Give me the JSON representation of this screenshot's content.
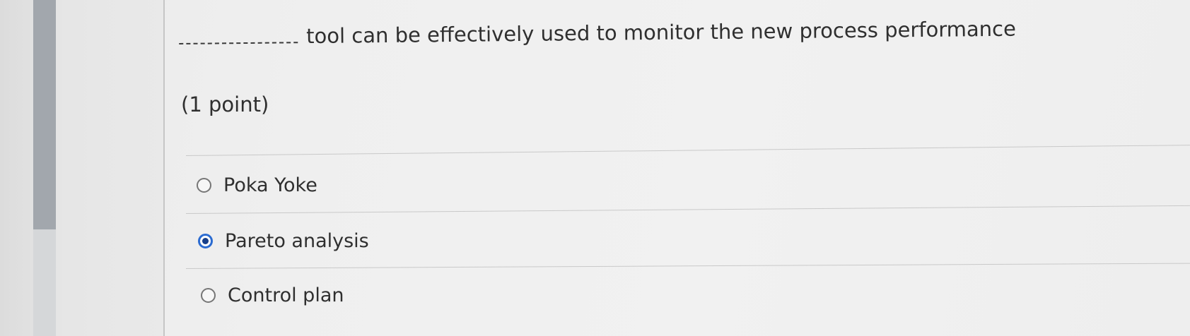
{
  "question": {
    "blank": "___________",
    "text": "tool can be effectively used to monitor the new process performance",
    "points": "(1 point)"
  },
  "options": [
    {
      "label": "Poka Yoke",
      "selected": false
    },
    {
      "label": "Pareto analysis",
      "selected": true
    },
    {
      "label": "Control plan",
      "selected": false
    }
  ],
  "colors": {
    "selected_ring": "#2b6bd1",
    "selected_dot": "#173f8a",
    "text": "#2f2f2f"
  }
}
